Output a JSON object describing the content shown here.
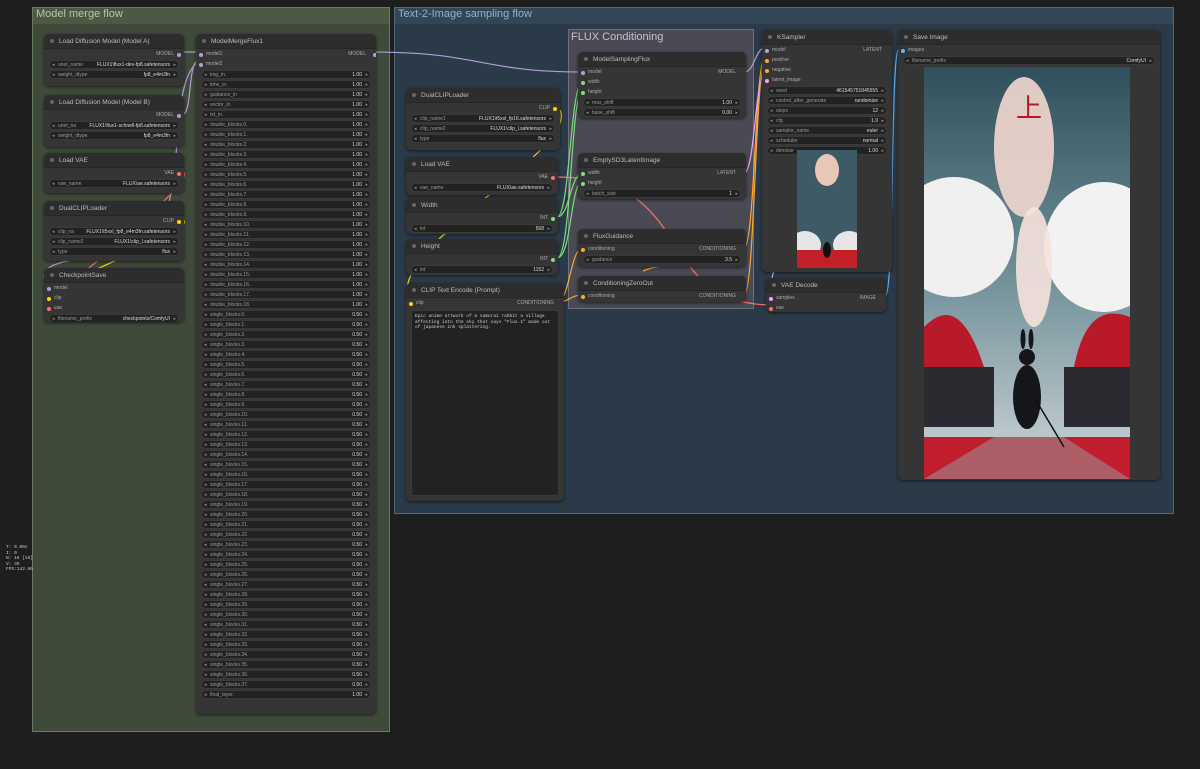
{
  "groups": {
    "merge": "Model merge flow",
    "t2i": "Text-2-Image sampling flow",
    "flux": "FLUX Conditioning"
  },
  "stats": [
    "T: 0.00s",
    "I: 0",
    "N: 16 [16]",
    "V: 36",
    "FPS:142.86"
  ],
  "colors": {
    "model": "#b39ddb",
    "clip": "#ffd500",
    "vae": "#ff6e6e",
    "latent": "#ff9cf9",
    "conditioning": "#ffa931",
    "int": "#7fde7f",
    "image": "#64b5f6"
  },
  "loadA": {
    "title": "Load Diffusion Model (Model A)",
    "out": "MODEL",
    "w1k": "unet_name",
    "w1v": "FLUX1\\flux1-dev-fp8.safetensors",
    "w2k": "weight_dtype",
    "w2v": "fp8_e4m3fn"
  },
  "loadB": {
    "title": "Load Diffusion Model (Model B)",
    "out": "MODEL",
    "w1k": "unet_na",
    "w1v": "FLUX1\\flux1-schnell-fp8.safetensors",
    "w2k": "weight_dtype",
    "w2v": "fp8_e4m3fn"
  },
  "loadVAE1": {
    "title": "Load VAE",
    "out": "VAE",
    "w1k": "vae_name",
    "w1v": "FLUX\\ae.safetensors"
  },
  "dualClip1": {
    "title": "DualCLIPLoader",
    "out": "CLIP",
    "w1k": "clip_na",
    "w1v": "FLUX1\\t5xxl_fp8_e4m3fn.safetensors",
    "w2k": "clip_name2",
    "w2v": "FLUX1\\clip_l.safetensors",
    "w3k": "type",
    "w3v": "flux"
  },
  "ckpt": {
    "title": "CheckpointSave",
    "in1": "model",
    "in2": "clip",
    "in3": "vae",
    "w1k": "filename_prefix",
    "w1v": "checkpoints/ComfyUI"
  },
  "merge": {
    "title": "ModelMergeFlux1",
    "in1": "model1",
    "in2": "model2",
    "out": "MODEL",
    "rows": [
      [
        "img_in.",
        "1.00"
      ],
      [
        "time_in.",
        "1.00"
      ],
      [
        "guidance_in",
        "1.00"
      ],
      [
        "vector_in.",
        "1.00"
      ],
      [
        "txt_in.",
        "1.00"
      ],
      [
        "double_blocks.0.",
        "1.00"
      ],
      [
        "double_blocks.1.",
        "1.00"
      ],
      [
        "double_blocks.2.",
        "1.00"
      ],
      [
        "double_blocks.3.",
        "1.00"
      ],
      [
        "double_blocks.4.",
        "1.00"
      ],
      [
        "double_blocks.5.",
        "1.00"
      ],
      [
        "double_blocks.6.",
        "1.00"
      ],
      [
        "double_blocks.7.",
        "1.00"
      ],
      [
        "double_blocks.8.",
        "1.00"
      ],
      [
        "double_blocks.9.",
        "1.00"
      ],
      [
        "double_blocks.10.",
        "1.00"
      ],
      [
        "double_blocks.11.",
        "1.00"
      ],
      [
        "double_blocks.12.",
        "1.00"
      ],
      [
        "double_blocks.13.",
        "1.00"
      ],
      [
        "double_blocks.14.",
        "1.00"
      ],
      [
        "double_blocks.15.",
        "1.00"
      ],
      [
        "double_blocks.16.",
        "1.00"
      ],
      [
        "double_blocks.17.",
        "1.00"
      ],
      [
        "double_blocks.18.",
        "1.00"
      ],
      [
        "single_blocks.0.",
        "0.50"
      ],
      [
        "single_blocks.1.",
        "0.50"
      ],
      [
        "single_blocks.2.",
        "0.50"
      ],
      [
        "single_blocks.3.",
        "0.50"
      ],
      [
        "single_blocks.4.",
        "0.50"
      ],
      [
        "single_blocks.5.",
        "0.50"
      ],
      [
        "single_blocks.6.",
        "0.50"
      ],
      [
        "single_blocks.7.",
        "0.50"
      ],
      [
        "single_blocks.8.",
        "0.50"
      ],
      [
        "single_blocks.9.",
        "0.50"
      ],
      [
        "single_blocks.10.",
        "0.50"
      ],
      [
        "single_blocks.11.",
        "0.50"
      ],
      [
        "single_blocks.12.",
        "0.50"
      ],
      [
        "single_blocks.13.",
        "0.50"
      ],
      [
        "single_blocks.14.",
        "0.50"
      ],
      [
        "single_blocks.15.",
        "0.50"
      ],
      [
        "single_blocks.16.",
        "0.50"
      ],
      [
        "single_blocks.17.",
        "0.50"
      ],
      [
        "single_blocks.18.",
        "0.50"
      ],
      [
        "single_blocks.19.",
        "0.50"
      ],
      [
        "single_blocks.20.",
        "0.50"
      ],
      [
        "single_blocks.21.",
        "0.50"
      ],
      [
        "single_blocks.22.",
        "0.50"
      ],
      [
        "single_blocks.23.",
        "0.50"
      ],
      [
        "single_blocks.24.",
        "0.50"
      ],
      [
        "single_blocks.25.",
        "0.50"
      ],
      [
        "single_blocks.26.",
        "0.50"
      ],
      [
        "single_blocks.27.",
        "0.50"
      ],
      [
        "single_blocks.28.",
        "0.50"
      ],
      [
        "single_blocks.29.",
        "0.50"
      ],
      [
        "single_blocks.30.",
        "0.50"
      ],
      [
        "single_blocks.31.",
        "0.50"
      ],
      [
        "single_blocks.32.",
        "0.50"
      ],
      [
        "single_blocks.33.",
        "0.50"
      ],
      [
        "single_blocks.34.",
        "0.50"
      ],
      [
        "single_blocks.35.",
        "0.50"
      ],
      [
        "single_blocks.36.",
        "0.50"
      ],
      [
        "single_blocks.37.",
        "0.50"
      ],
      [
        "final_layer.",
        "1.00"
      ]
    ]
  },
  "dualClip2": {
    "title": "DualCLIPLoader",
    "out": "CLIP",
    "w1k": "clip_name1",
    "w1v": "FLUX1\\t5xxl_fp16.safetensors",
    "w2k": "clip_name2",
    "w2v": "FLUX1\\clip_l.safetensors",
    "w3k": "type",
    "w3v": "flux"
  },
  "loadVAE2": {
    "title": "Load VAE",
    "out": "VAE",
    "w1k": "vae_name",
    "w1v": "FLUX\\ae.safetensors"
  },
  "width": {
    "title": "Width",
    "out": "INT",
    "w1k": "int",
    "w1v": "568"
  },
  "height": {
    "title": "Height",
    "out": "INT",
    "w1k": "int",
    "w1v": "1152"
  },
  "clipText": {
    "title": "CLIP Text Encode (Prompt)",
    "in": "clip",
    "out": "CONDITIONING",
    "text": "Epic anime artwork of a samurai rabbit a village affecting into the sky that says \"Flux.1\" made out of japanese ink splattering."
  },
  "msf": {
    "title": "ModelSamplingFlux",
    "in1": "model",
    "in2": "width",
    "in3": "height",
    "out": "MODEL",
    "w1k": "max_shift",
    "w1v": "1.00",
    "w2k": "base_shift",
    "w2v": "0.00"
  },
  "empty": {
    "title": "EmptySD3LatentImage",
    "in1": "width",
    "in2": "height",
    "out": "LATENT",
    "w1k": "batch_size",
    "w1v": "1"
  },
  "fluxg": {
    "title": "FluxGuidance",
    "in": "conditioning",
    "out": "CONDITIONING",
    "w1k": "guidance",
    "w1v": "3.5"
  },
  "czo": {
    "title": "ConditioningZeroOut",
    "in": "conditioning",
    "out": "CONDITIONING"
  },
  "ksampler": {
    "title": "KSampler",
    "in1": "model",
    "in2": "positive",
    "in3": "negative",
    "in4": "latent_image",
    "out": "LATENT",
    "rows": [
      [
        "seed",
        "461545751845555"
      ],
      [
        "control_after_generate",
        "randomize"
      ],
      [
        "steps",
        "12"
      ],
      [
        "cfg",
        "1.0"
      ],
      [
        "sampler_name",
        "euler"
      ],
      [
        "scheduler",
        "normal"
      ],
      [
        "denoise",
        "1.00"
      ]
    ]
  },
  "vaedec": {
    "title": "VAE Decode",
    "in1": "samples",
    "in2": "vae",
    "out": "IMAGE"
  },
  "save": {
    "title": "Save Image",
    "in": "images",
    "w1k": "filename_prefix",
    "w1v": "ComfyUI"
  }
}
